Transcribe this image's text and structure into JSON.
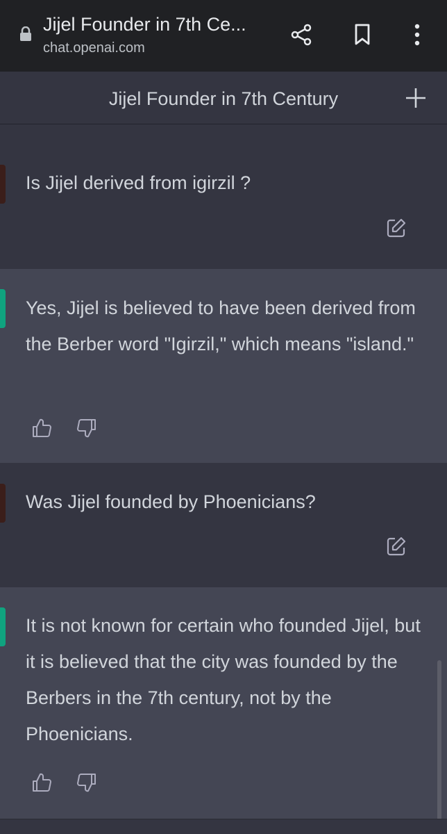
{
  "browser": {
    "tab_title": "Jijel Founder in 7th Ce...",
    "url": "chat.openai.com"
  },
  "chat": {
    "title": "Jijel Founder in 7th Century"
  },
  "messages": [
    {
      "role": "user",
      "text": "Is Jijel derived from igirzil ?"
    },
    {
      "role": "assistant",
      "text": "Yes, Jijel is believed to have been derived from the Berber word \"Igirzil,\" which means \"island.\""
    },
    {
      "role": "user",
      "text": "Was Jijel founded by Phoenicians?"
    },
    {
      "role": "assistant",
      "text": "It is not known for certain who founded Jijel, but it is believed that the city was founded by the Berbers in the 7th century, not by the Phoenicians."
    }
  ],
  "icons": [
    "lock-icon",
    "share-icon",
    "bookmark-icon",
    "more-vert-icon",
    "plus-icon",
    "edit-icon",
    "thumbs-up-icon",
    "thumbs-down-icon"
  ],
  "colors": {
    "accent": "#10a37f",
    "bg_user": "#343541",
    "bg_assistant": "#444654",
    "browser_bar": "#202124"
  }
}
